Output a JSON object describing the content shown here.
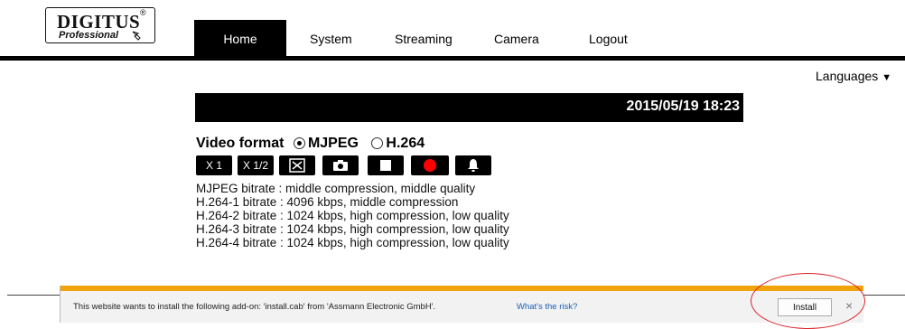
{
  "logo": {
    "brand": "DIGITUS",
    "registered": "®",
    "subtitle": "Professional"
  },
  "nav": {
    "tabs": [
      {
        "label": "Home",
        "active": true
      },
      {
        "label": "System"
      },
      {
        "label": "Streaming"
      },
      {
        "label": "Camera"
      },
      {
        "label": "Logout"
      }
    ]
  },
  "languages": {
    "label": "Languages",
    "arrow": "▼"
  },
  "datetime": "2015/05/19 18:23",
  "video_format": {
    "label": "Video format",
    "options": [
      "MJPEG",
      "H.264"
    ],
    "selected": "MJPEG"
  },
  "controls": [
    {
      "label": "X 1",
      "icon": "zoom-1x"
    },
    {
      "label": "X 1/2",
      "icon": "zoom-half"
    },
    {
      "label": "",
      "icon": "fullscreen-icon"
    },
    {
      "label": "",
      "icon": "camera-icon"
    },
    {
      "label": "",
      "icon": "stop-icon"
    },
    {
      "label": "",
      "icon": "record-icon"
    },
    {
      "label": "",
      "icon": "bell-icon"
    }
  ],
  "bitrates": [
    "MJPEG bitrate : middle compression, middle quality",
    "H.264-1 bitrate : 4096 kbps, middle compression",
    "H.264-2 bitrate : 1024 kbps, high compression, low quality",
    "H.264-3 bitrate : 1024 kbps, high compression, low quality",
    "H.264-4 bitrate : 1024 kbps, high compression, low quality"
  ],
  "notification": {
    "message": "This website wants to install the following add-on: 'install.cab' from 'Assmann Electronic GmbH'.",
    "risk_link": "What's the risk?",
    "install_label": "Install",
    "close_label": "×"
  },
  "colors": {
    "bar": "#000000",
    "notification_accent": "#f0a30a",
    "highlight_circle": "#d9232a",
    "record": "#ff0000"
  }
}
